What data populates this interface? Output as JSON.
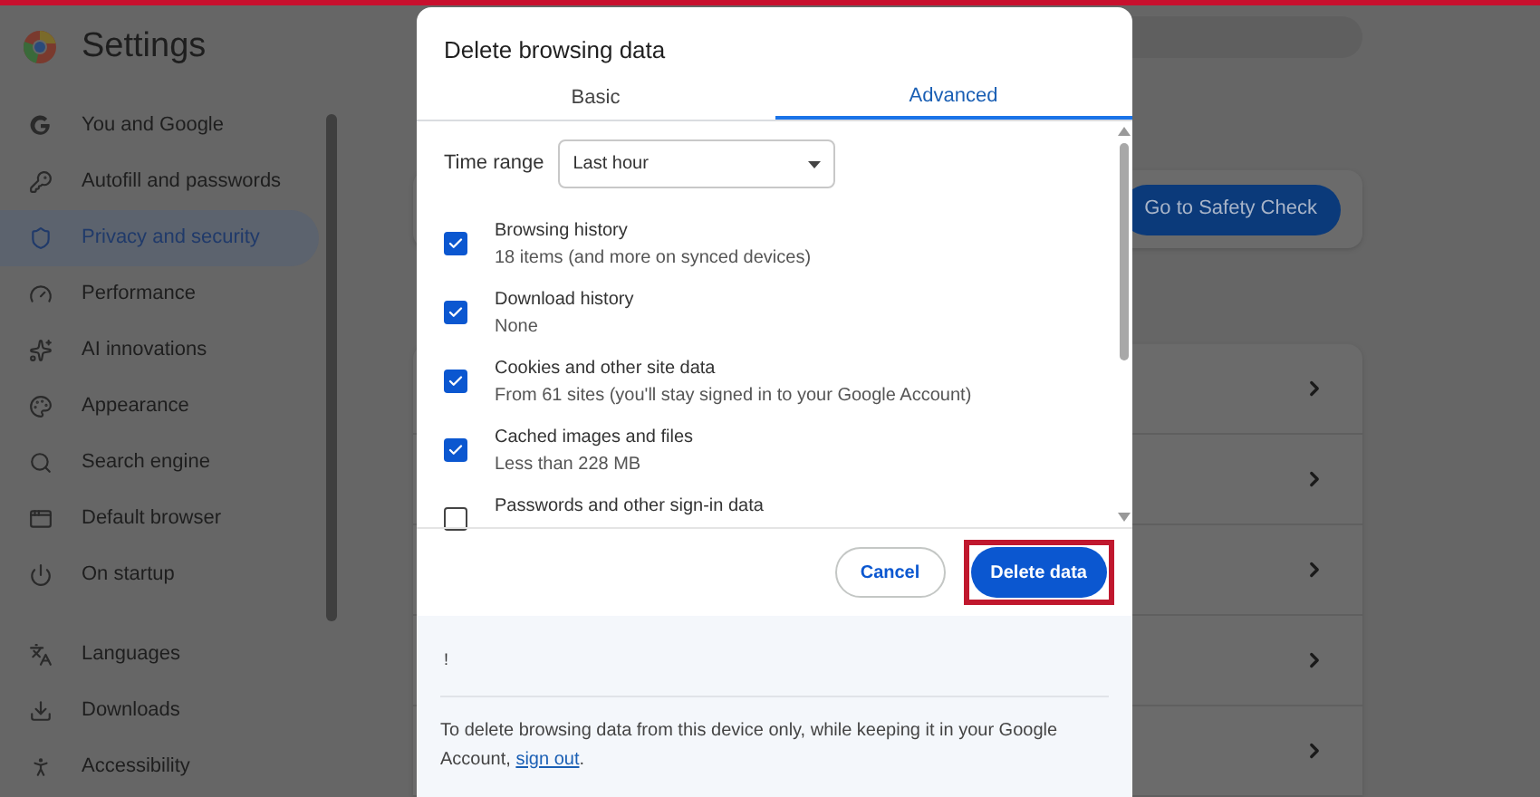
{
  "app": {
    "title": "Settings"
  },
  "sidebar": {
    "items": [
      {
        "label": "You and Google",
        "selected": false
      },
      {
        "label": "Autofill and passwords",
        "selected": false
      },
      {
        "label": "Privacy and security",
        "selected": true
      },
      {
        "label": "Performance",
        "selected": false
      },
      {
        "label": "AI innovations",
        "selected": false
      },
      {
        "label": "Appearance",
        "selected": false
      },
      {
        "label": "Search engine",
        "selected": false
      },
      {
        "label": "Default browser",
        "selected": false
      },
      {
        "label": "On startup",
        "selected": false
      },
      {
        "label": "Languages",
        "selected": false
      },
      {
        "label": "Downloads",
        "selected": false
      },
      {
        "label": "Accessibility",
        "selected": false
      }
    ]
  },
  "main": {
    "safety_button": "Go to Safety Check"
  },
  "dialog": {
    "title": "Delete browsing data",
    "tabs": [
      {
        "label": "Basic",
        "selected": false
      },
      {
        "label": "Advanced",
        "selected": true
      }
    ],
    "time_range": {
      "label": "Time range",
      "value": "Last hour"
    },
    "options": [
      {
        "title": "Browsing history",
        "detail": "18 items (and more on synced devices)",
        "checked": true
      },
      {
        "title": "Download history",
        "detail": "None",
        "checked": true
      },
      {
        "title": "Cookies and other site data",
        "detail": "From 61 sites (you'll stay signed in to your Google Account)",
        "checked": true
      },
      {
        "title": "Cached images and files",
        "detail": "Less than 228 MB",
        "checked": true
      },
      {
        "title": "Passwords and other sign-in data",
        "checked": false
      }
    ],
    "buttons": [
      {
        "label": "Cancel",
        "kind": "secondary",
        "highlighted": false
      },
      {
        "label": "Delete data",
        "kind": "primary",
        "highlighted": true
      }
    ],
    "notice_mark": "!",
    "footer": {
      "text": "To delete browsing data from this device only, while keeping it in your Google Account, ",
      "link": "sign out",
      "after": "."
    }
  }
}
